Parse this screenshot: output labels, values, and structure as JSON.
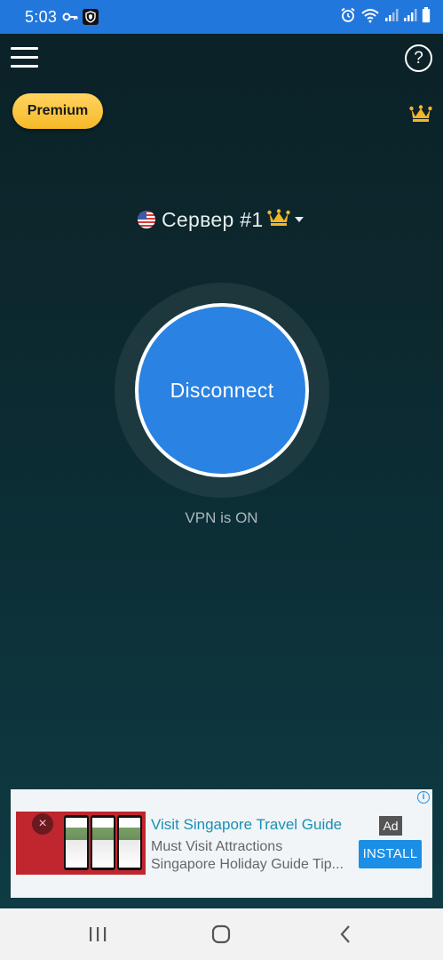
{
  "status_bar": {
    "time": "5:03",
    "icons": [
      "vpn-key-icon",
      "shield-app-icon",
      "alarm-icon",
      "wifi-icon",
      "signal-icon",
      "signal-icon",
      "battery-icon"
    ]
  },
  "header": {
    "menu_icon": "hamburger-menu-icon",
    "help_label": "?",
    "premium_label": "Premium",
    "crown_icon": "crown-icon"
  },
  "server": {
    "flag": "us-flag-icon",
    "name": "Сервер #1",
    "crown_icon": "crown-icon",
    "dropdown_icon": "caret-down-icon"
  },
  "connection": {
    "button_label": "Disconnect",
    "status_text": "VPN is ON"
  },
  "ad": {
    "title": "Visit Singapore Travel Guide",
    "line1": "Must Visit Attractions",
    "line2": "Singapore Holiday Guide Tip...",
    "badge": "Ad",
    "cta": "INSTALL",
    "info_label": "i",
    "image_close": "×"
  },
  "nav": {
    "recents_icon": "recents-icon",
    "home_icon": "home-icon",
    "back_icon": "back-icon"
  },
  "colors": {
    "status_bar": "#2277dd",
    "background": "#0c2b32",
    "button": "#2a82e2",
    "premium": "#f6b928",
    "crown": "#f4b626",
    "install": "#1b8ee6",
    "ad_title": "#1a8fb3"
  }
}
